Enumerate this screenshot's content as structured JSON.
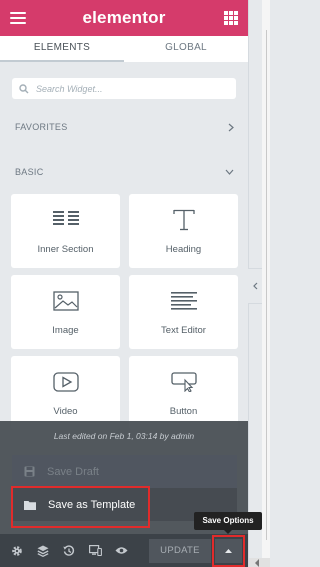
{
  "header": {
    "logo": "elementor",
    "brand_color": "#d53b6b"
  },
  "tabs": [
    {
      "label": "ELEMENTS",
      "active": true
    },
    {
      "label": "GLOBAL",
      "active": false
    }
  ],
  "search": {
    "placeholder": "Search Widget..."
  },
  "categories": {
    "favorites": "FAVORITES",
    "basic": "BASIC"
  },
  "widgets": [
    {
      "label": "Inner Section",
      "icon": "inner-section-icon"
    },
    {
      "label": "Heading",
      "icon": "heading-icon"
    },
    {
      "label": "Image",
      "icon": "image-icon"
    },
    {
      "label": "Text Editor",
      "icon": "text-editor-icon"
    },
    {
      "label": "Video",
      "icon": "video-icon"
    },
    {
      "label": "Button",
      "icon": "button-icon"
    }
  ],
  "save_menu": {
    "last_edited": "Last edited on Feb 1, 03:14 by admin",
    "save_draft": "Save Draft",
    "save_template": "Save as Template"
  },
  "footer": {
    "icons": [
      "settings-icon",
      "navigator-icon",
      "history-icon",
      "responsive-mode-icon",
      "preview-icon"
    ],
    "update_label": "UPDATE",
    "tooltip": "Save Options"
  },
  "highlight_color": "#e12b2b"
}
